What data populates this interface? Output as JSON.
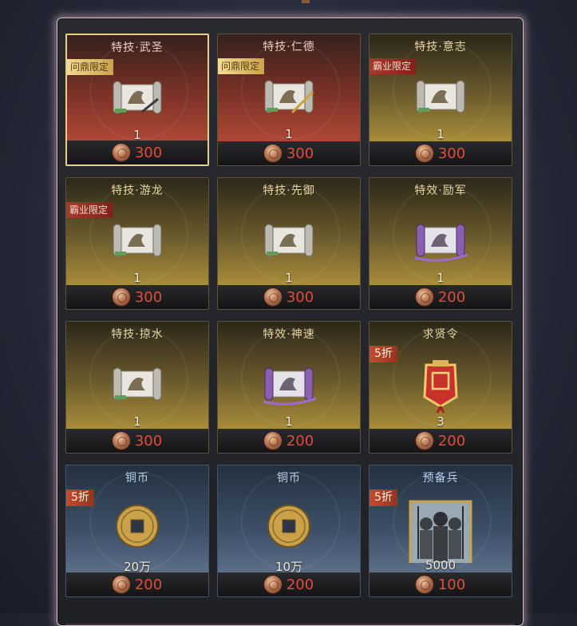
{
  "shop": {
    "cards": [
      {
        "title": "特技·武圣",
        "tag": "问鼎限定",
        "qty": "1",
        "price": "300",
        "icon": "scroll-icon"
      },
      {
        "title": "特技·仁德",
        "tag": "问鼎限定",
        "qty": "1",
        "price": "300",
        "icon": "scroll-icon"
      },
      {
        "title": "特技·意志",
        "tag": "霸业限定",
        "qty": "1",
        "price": "300",
        "icon": "scroll-icon"
      },
      {
        "title": "特技·游龙",
        "tag": "霸业限定",
        "qty": "1",
        "price": "300",
        "icon": "scroll-icon"
      },
      {
        "title": "特技·先御",
        "tag": "",
        "qty": "1",
        "price": "300",
        "icon": "scroll-icon"
      },
      {
        "title": "特效·励军",
        "tag": "",
        "qty": "1",
        "price": "200",
        "icon": "purple-scroll-icon"
      },
      {
        "title": "特技·掠水",
        "tag": "",
        "qty": "1",
        "price": "300",
        "icon": "scroll-icon"
      },
      {
        "title": "特效·神速",
        "tag": "",
        "qty": "1",
        "price": "200",
        "icon": "purple-scroll-icon"
      },
      {
        "title": "求贤令",
        "tag": "5折",
        "qty": "3",
        "price": "200",
        "icon": "token-icon"
      },
      {
        "title": "铜币",
        "tag": "5折",
        "qty": "20万",
        "price": "200",
        "icon": "copper-coin-icon"
      },
      {
        "title": "铜币",
        "tag": "",
        "qty": "10万",
        "price": "200",
        "icon": "copper-coin-icon"
      },
      {
        "title": "预备兵",
        "tag": "5折",
        "qty": "5000",
        "price": "100",
        "icon": "reserve-soldiers-icon"
      }
    ]
  },
  "colors": {
    "price": "#e24b3b",
    "gold_tag": "#f3dc92",
    "red_tag": "#a73a2d",
    "discount_tag": "#c44b2e"
  }
}
